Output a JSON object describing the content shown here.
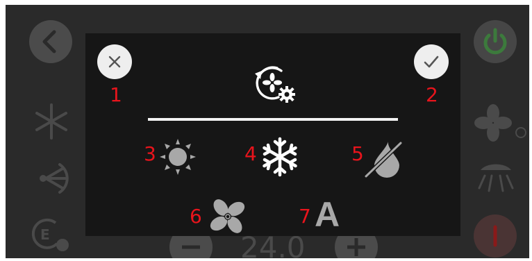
{
  "background": {
    "temperature": "24.0"
  },
  "modal": {
    "header_icon": "fan-settings-icon",
    "close_icon": "close-icon",
    "confirm_icon": "check-icon"
  },
  "callouts": {
    "close": "1",
    "confirm": "2",
    "heat": "3",
    "cool": "4",
    "dry": "5",
    "fan": "6",
    "auto": "7"
  },
  "modes": {
    "auto_label": "A"
  },
  "colors": {
    "modal_bg": "#161616",
    "screen_bg": "#2a2a2a",
    "callout": "#e8141c",
    "inactive_icon": "#a8a8a8",
    "active_icon": "#ffffff",
    "power_green": "#3c7a3c",
    "alert_red": "#8a1a1a"
  }
}
